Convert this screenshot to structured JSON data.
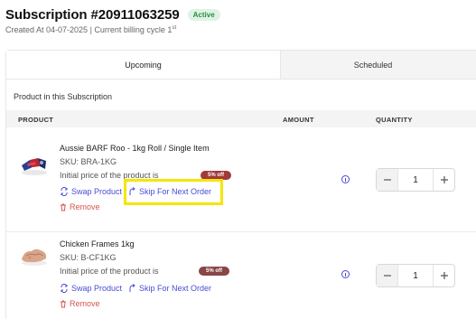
{
  "header": {
    "title": "Subscription #20911063259",
    "status": "Active",
    "created": "Created At 04-07-2025 | Current billing cycle 1",
    "cycle_suffix": "st"
  },
  "tabs": [
    "Upcoming",
    "Scheduled"
  ],
  "section_title": "Product in this Subscription",
  "columns": {
    "product": "PRODUCT",
    "amount": "AMOUNT",
    "quantity": "QUANTITY"
  },
  "products": [
    {
      "name": "Aussie BARF Roo - 1kg Roll / Single Item",
      "sku": "SKU: BRA-1KG",
      "price_label": "Initial price of the product is",
      "discount": "5% off",
      "swap_label": "Swap Product",
      "skip_label": "Skip For Next Order",
      "remove_label": "Remove",
      "quantity": "1",
      "highlighted_action": "Skip For Next Order"
    },
    {
      "name": "Chicken Frames 1kg",
      "sku": "SKU: B-CF1KG",
      "price_label": "Initial price of the product is",
      "discount": "5% off",
      "swap_label": "Swap Product",
      "skip_label": "Skip For Next Order",
      "remove_label": "Remove",
      "quantity": "1"
    }
  ],
  "colors": {
    "accent": "#4b4bd6",
    "danger": "#d9534f",
    "discount_badge_1": "#a33a3a",
    "discount_badge_2": "#8a4545",
    "active_badge_bg": "#dff3e4",
    "active_badge_text": "#2e8b47",
    "highlight": "#f5e600"
  },
  "icons": {
    "swap": "swap-arrows-icon",
    "skip": "skip-arrow-icon",
    "remove": "trash-icon",
    "info": "info-circle-icon",
    "minus": "minus-icon",
    "plus": "plus-icon"
  }
}
